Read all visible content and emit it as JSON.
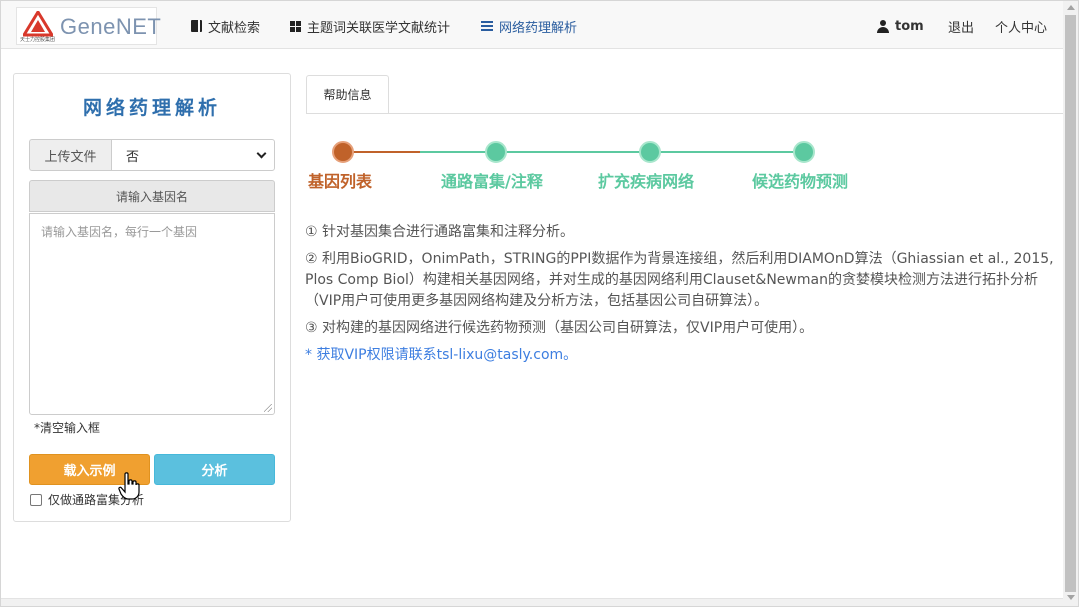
{
  "brand": {
    "name": "GeneNET",
    "subtitle": "天士力控股集团",
    "colors": {
      "logo_red": "#d8382b",
      "logo_text": "#7d93b0"
    }
  },
  "nav": {
    "items": [
      {
        "label": "文献检索",
        "icon": "book-icon"
      },
      {
        "label": "主题词关联医学文献统计",
        "icon": "grid-icon"
      },
      {
        "label": "网络药理解析",
        "icon": "list-icon",
        "active": true
      }
    ],
    "user": {
      "name": "tom",
      "icon": "user-icon"
    },
    "logout": "退出",
    "profile": "个人中心"
  },
  "panel": {
    "title": "网络药理解析",
    "upload_label": "上传文件",
    "upload_value": "否",
    "gene_header": "请输入基因名",
    "gene_placeholder": "请输入基因名，每行一个基因",
    "clear_link": "*清空输入框",
    "load_button": "载入示例",
    "analyze_button": "分析",
    "checkbox_label": "仅做通路富集分析",
    "colors": {
      "load": "#f0a030",
      "analyze": "#5bc0de",
      "title": "#2f6fad"
    }
  },
  "help": {
    "tab": "帮助信息",
    "steps": [
      {
        "label": "基因列表",
        "state": "current",
        "color": "#c0622a"
      },
      {
        "label": "通路富集/注释",
        "state": "pending",
        "color": "#5cc9a0"
      },
      {
        "label": "扩充疾病网络",
        "state": "pending",
        "color": "#5cc9a0"
      },
      {
        "label": "候选药物预测",
        "state": "pending",
        "color": "#5cc9a0"
      }
    ],
    "paragraphs": [
      "① 针对基因集合进行通路富集和注释分析。",
      "② 利用BioGRID，OnimPath，STRING的PPI数据作为背景连接组，然后利用DIAMOnD算法（Ghiassian et al., 2015, Plos Comp Biol）构建相关基因网络，并对生成的基因网络利用Clauset&Newman的贪婪模块检测方法进行拓扑分析（VIP用户可使用更多基因网络构建及分析方法，包括基因公司自研算法）。",
      "③ 对构建的基因网络进行候选药物预测（基因公司自研算法，仅VIP用户可使用）。"
    ],
    "vip_note": "* 获取VIP权限请联系tsl-lixu@tasly.com。"
  }
}
